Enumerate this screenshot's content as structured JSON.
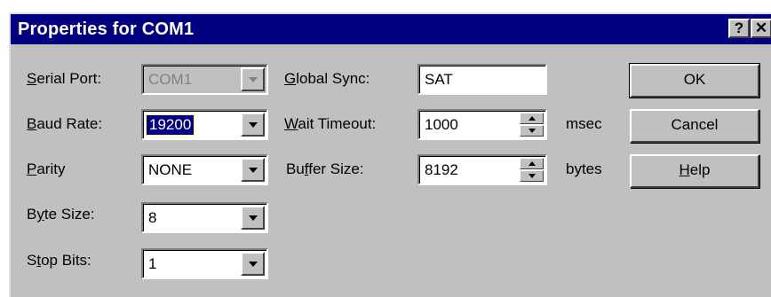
{
  "window": {
    "title": "Properties for COM1",
    "help_glyph": "?",
    "close_glyph": "✕"
  },
  "left": {
    "serial_port": {
      "label_u": "S",
      "label_rest": "erial Port:",
      "value": "COM1"
    },
    "baud_rate": {
      "label_u": "B",
      "label_rest": "aud Rate:",
      "value": "19200"
    },
    "parity": {
      "label_u": "P",
      "label_rest": "arity",
      "value": "NONE"
    },
    "byte_size": {
      "label_pre": "B",
      "label_u": "y",
      "label_rest": "te Size:",
      "value": "8"
    },
    "stop_bits": {
      "label_pre": "S",
      "label_u": "t",
      "label_rest": "op Bits:",
      "value": "1"
    }
  },
  "middle": {
    "global_sync": {
      "label_u": "G",
      "label_rest": "lobal Sync:",
      "value": "SAT"
    },
    "wait_timeout": {
      "label_u": "W",
      "label_rest": "ait Timeout:",
      "value": "1000",
      "unit": "msec"
    },
    "buffer_size": {
      "label_pre": "Bu",
      "label_u": "f",
      "label_rest": "fer Size:",
      "value": "8192",
      "unit": "bytes"
    }
  },
  "buttons": {
    "ok": "OK",
    "cancel": "Cancel",
    "help_u": "H",
    "help_rest": "elp"
  },
  "icons": {
    "dropdown": "chevron-down-icon",
    "spin": "spin-arrows-icon"
  }
}
